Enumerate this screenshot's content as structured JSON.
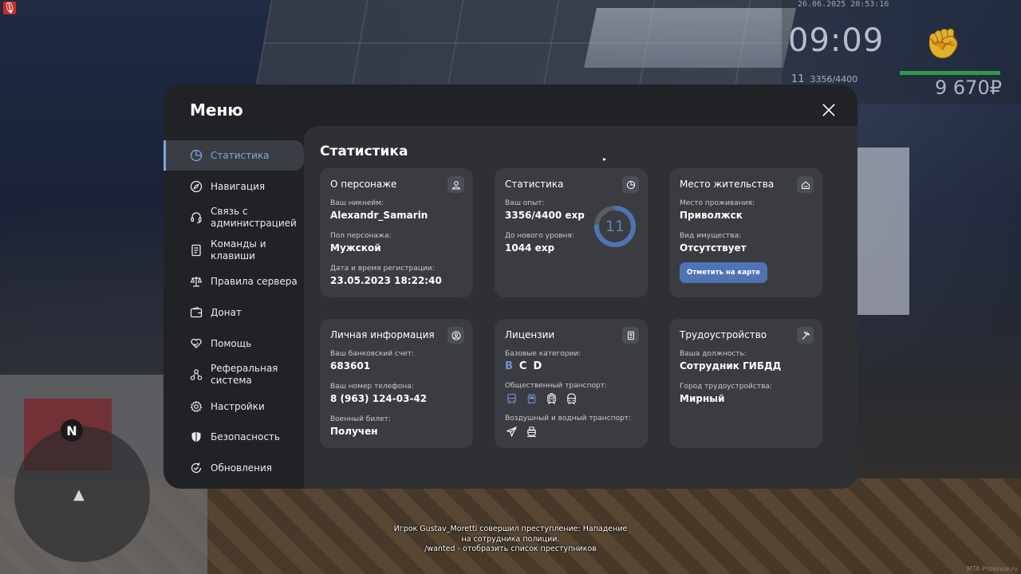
{
  "hud": {
    "datetime": "26.06.2025 20:53:16",
    "time": "09:09",
    "level": "11",
    "exp": "3356/4400",
    "money": "9 670₽",
    "health_color": "#2f9a46"
  },
  "menu": {
    "title": "Меню",
    "sidebar": [
      {
        "label": "Статистика",
        "icon": "pie-chart-icon",
        "active": true
      },
      {
        "label": "Навигация",
        "icon": "compass-icon",
        "active": false
      },
      {
        "label": "Связь с администрацией",
        "icon": "headset-icon",
        "active": false
      },
      {
        "label": "Команды и клавиши",
        "icon": "document-list-icon",
        "active": false
      },
      {
        "label": "Правила сервера",
        "icon": "scales-icon",
        "active": false
      },
      {
        "label": "Донат",
        "icon": "wallet-icon",
        "active": false
      },
      {
        "label": "Помощь",
        "icon": "heart-hands-icon",
        "active": false
      },
      {
        "label": "Реферальная система",
        "icon": "network-icon",
        "active": false
      },
      {
        "label": "Настройки",
        "icon": "gear-icon",
        "active": false
      },
      {
        "label": "Безопасность",
        "icon": "shield-icon",
        "active": false
      },
      {
        "label": "Обновления",
        "icon": "check-refresh-icon",
        "active": false
      }
    ],
    "content_title": "Статистика",
    "cards": {
      "character": {
        "title": "О персонаже",
        "nickname_label": "Ваш никнейм:",
        "nickname": "Alexandr_Samarin",
        "gender_label": "Пол персонажа:",
        "gender": "Мужской",
        "reg_label": "Дата и время регистрации:",
        "reg": "23.05.2023 18:22:40"
      },
      "stats": {
        "title": "Статистика",
        "exp_label": "Ваш опыт:",
        "exp": "3356/4400 exp",
        "next_label": "До нового уровня:",
        "next": "1044 exp",
        "level": "11",
        "progress": 0.763
      },
      "residence": {
        "title": "Место жительства",
        "place_label": "Место проживания:",
        "place": "Приволжск",
        "property_label": "Вид имущества:",
        "property": "Отсутствует",
        "button": "Отметить на карте"
      },
      "personal": {
        "title": "Личная информация",
        "bank_label": "Ваш банковский счет:",
        "bank": "683601",
        "phone_label": "Ваш номер телефона:",
        "phone": "8 (963) 124-03-42",
        "military_label": "Военный билет:",
        "military": "Получен"
      },
      "licenses": {
        "title": "Лицензии",
        "basic_label": "Базовые категории:",
        "categories": [
          {
            "label": "B",
            "active": true
          },
          {
            "label": "C",
            "active": false
          },
          {
            "label": "D",
            "active": false
          }
        ],
        "public_label": "Общественный транспорт:",
        "air_label": "Воздушный и водный транспорт:"
      },
      "employment": {
        "title": "Трудоустройство",
        "position_label": "Ваша должность:",
        "position": "Сотрудник ГИБДД",
        "city_label": "Город трудоустройства:",
        "city": "Мирный"
      }
    }
  },
  "chat": {
    "line1": "Игрок Gustav_Moretti совершил преступление: Нападение",
    "line2": "на сотрудника полиции.",
    "line3": "/wanted - отобразить список преступников"
  },
  "minimap": {
    "north": "N"
  },
  "watermark": "MTA Province.ru",
  "colors": {
    "accent": "#7ea6e0",
    "button": "#4f74b5",
    "panel": "#212225",
    "card": "#3a3c41"
  }
}
